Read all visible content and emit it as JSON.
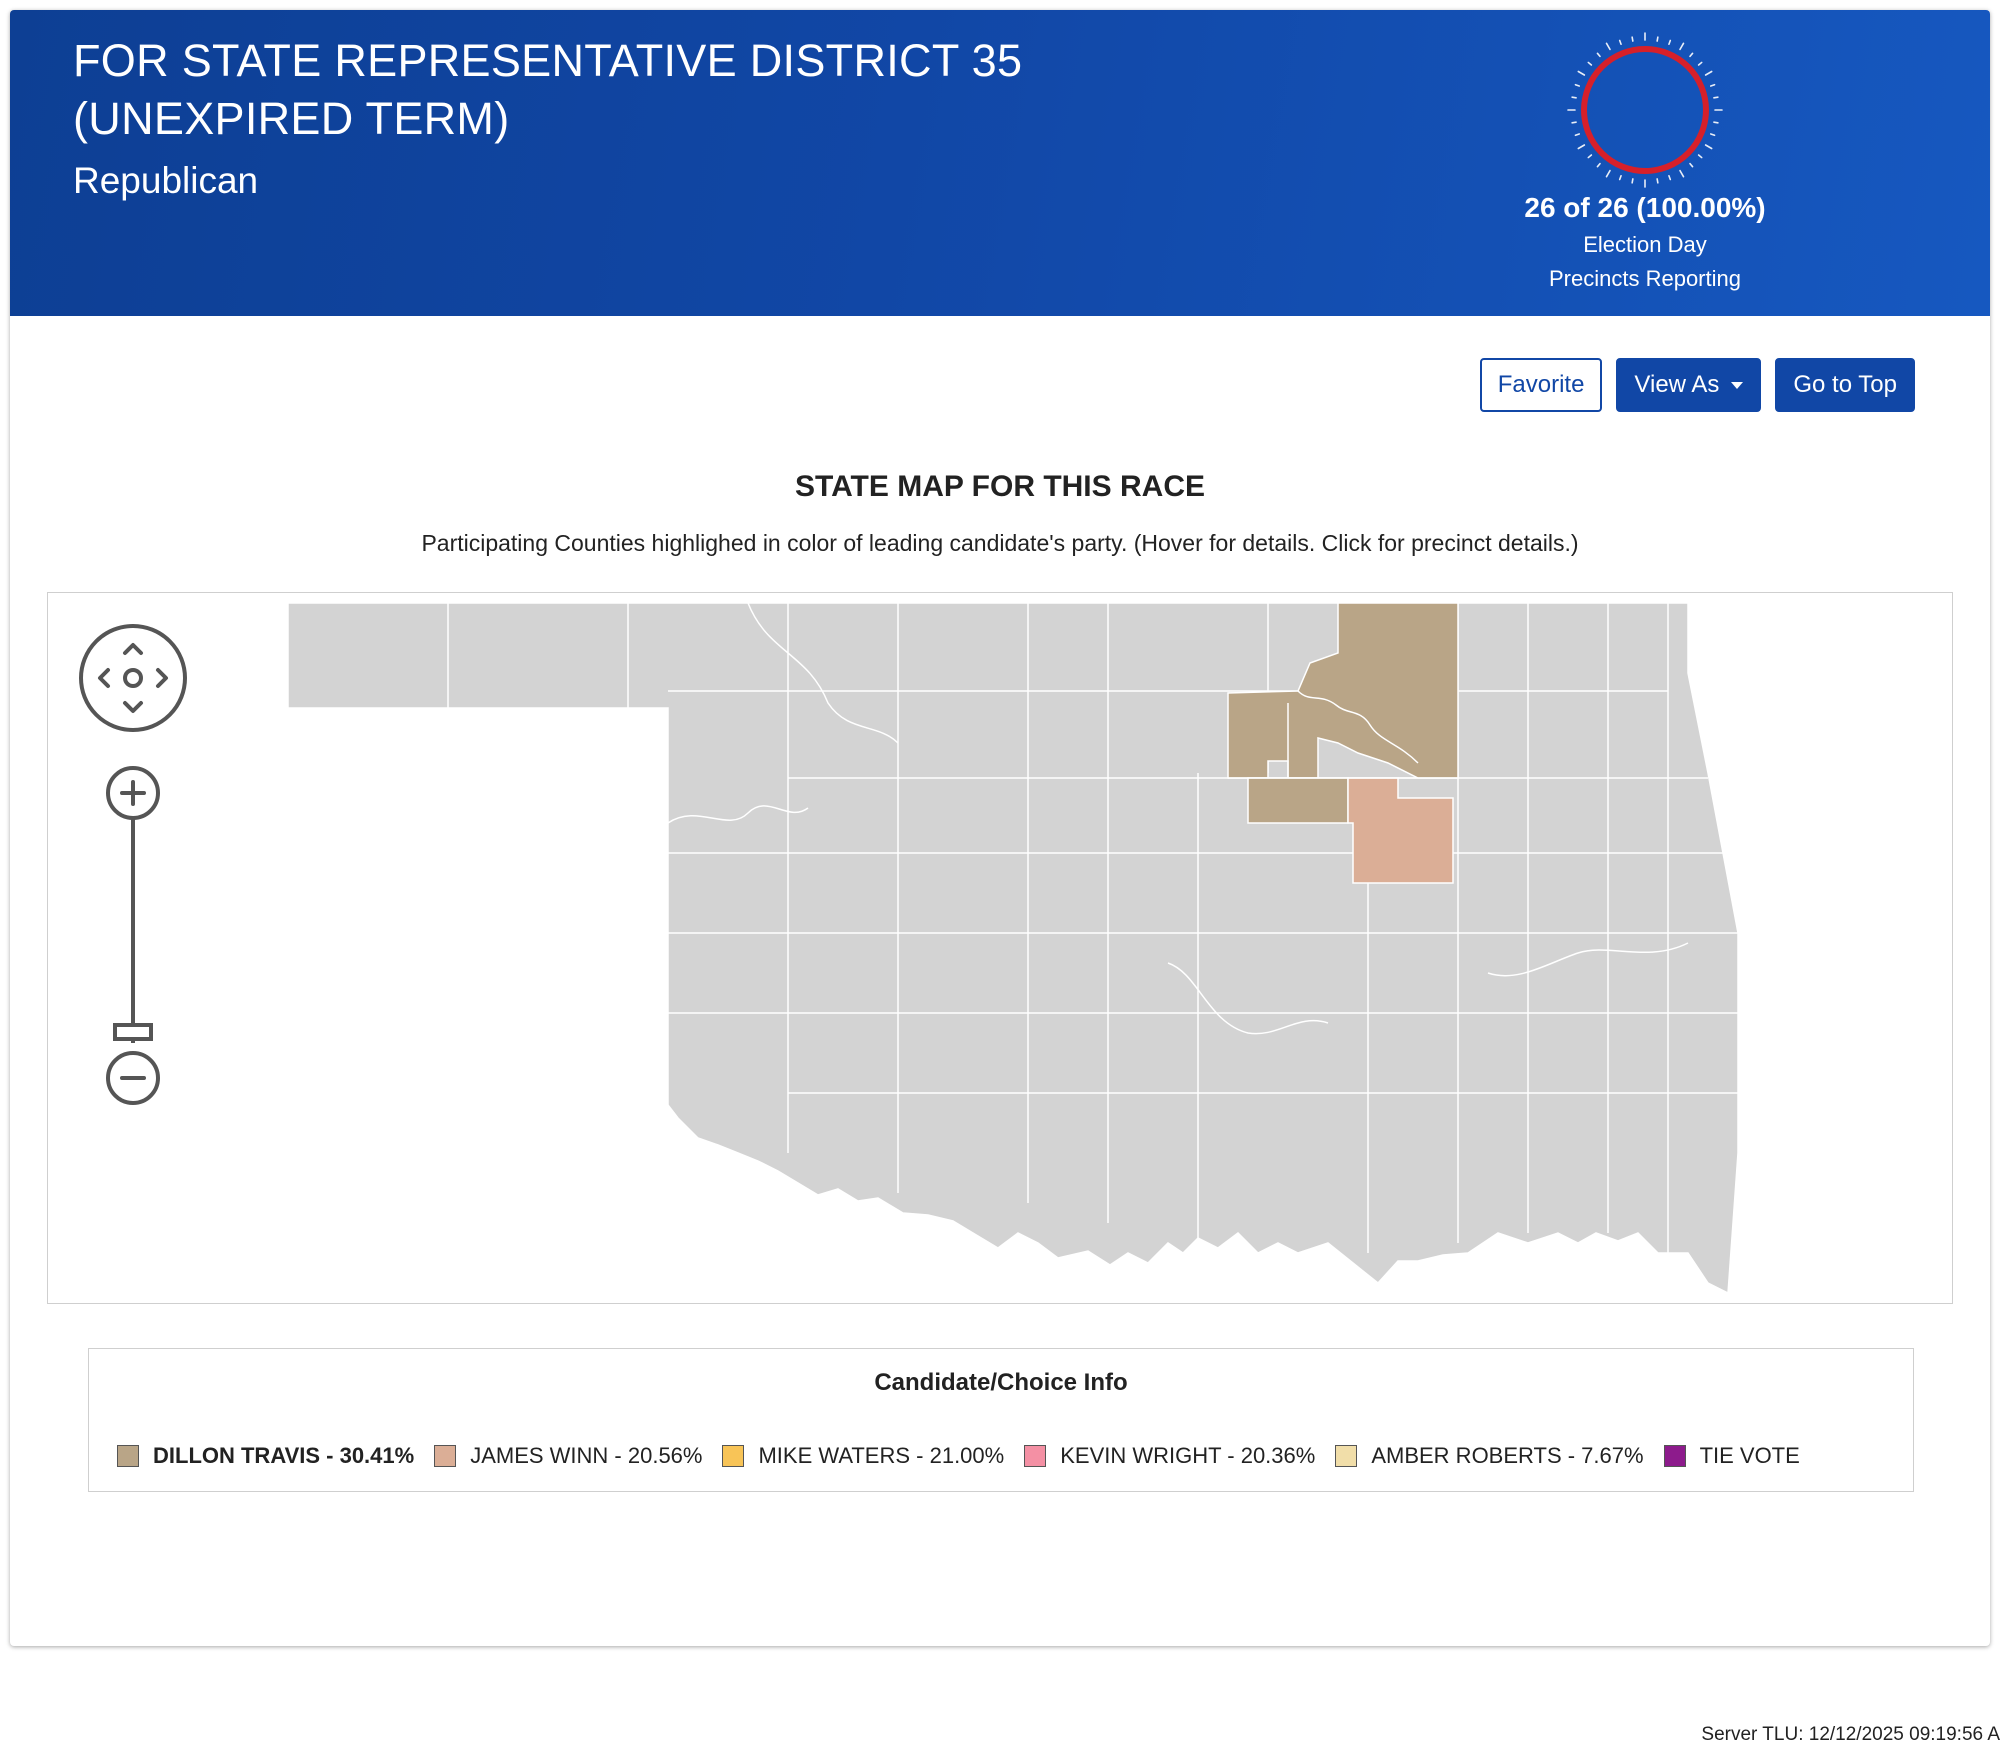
{
  "header": {
    "title_line1": "FOR STATE REPRESENTATIVE DISTRICT 35",
    "title_line2": "(UNEXPIRED TERM)",
    "party": "Republican",
    "reporting_count": "26 of 26 (100.00%)",
    "reporting_label1": "Election Day",
    "reporting_label2": "Precincts Reporting",
    "reporting_fraction": 1.0
  },
  "toolbar": {
    "favorite_label": "Favorite",
    "view_as_label": "View As",
    "go_top_label": "Go to Top"
  },
  "map": {
    "heading": "STATE MAP FOR THIS RACE",
    "subheading": "Participating Counties highlighed in color of leading candidate's party. (Hover for details. Click for precinct details.)",
    "base_color": "#d3d3d3",
    "border_color": "#ffffff",
    "controls": [
      "pan-icon",
      "zoom-in-icon",
      "zoom-slider",
      "zoom-out-icon"
    ]
  },
  "legend": {
    "title": "Candidate/Choice Info",
    "items": [
      {
        "label": "DILLON TRAVIS - 30.41%",
        "color": "#b9a587",
        "leading": true
      },
      {
        "label": "JAMES WINN - 20.56%",
        "color": "#dbae96"
      },
      {
        "label": "MIKE WATERS - 21.00%",
        "color": "#f8c457"
      },
      {
        "label": "KEVIN WRIGHT - 20.36%",
        "color": "#f490a4"
      },
      {
        "label": "AMBER ROBERTS - 7.67%",
        "color": "#f1dea9"
      },
      {
        "label": "TIE VOTE",
        "color": "#8d1b8c"
      }
    ]
  },
  "footer": {
    "server_tlu": "Server TLU: 12/12/2025 09:19:56 A"
  },
  "colors": {
    "header_blue": "#1147a6",
    "ring_red": "#d6202a"
  }
}
